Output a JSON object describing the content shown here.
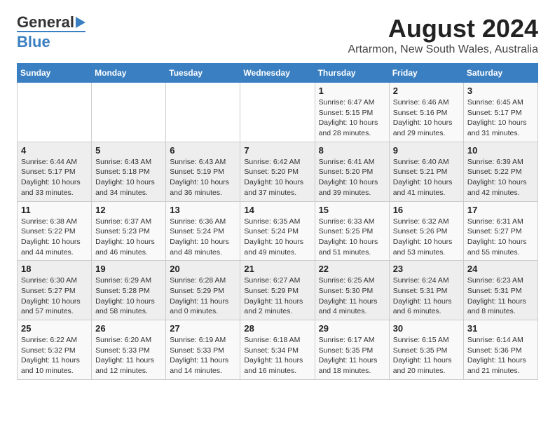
{
  "header": {
    "logo_line1": "General",
    "logo_line2": "Blue",
    "title": "August 2024",
    "subtitle": "Artarmon, New South Wales, Australia"
  },
  "calendar": {
    "days_of_week": [
      "Sunday",
      "Monday",
      "Tuesday",
      "Wednesday",
      "Thursday",
      "Friday",
      "Saturday"
    ],
    "weeks": [
      [
        {
          "day": "",
          "info": ""
        },
        {
          "day": "",
          "info": ""
        },
        {
          "day": "",
          "info": ""
        },
        {
          "day": "",
          "info": ""
        },
        {
          "day": "1",
          "info": "Sunrise: 6:47 AM\nSunset: 5:15 PM\nDaylight: 10 hours\nand 28 minutes."
        },
        {
          "day": "2",
          "info": "Sunrise: 6:46 AM\nSunset: 5:16 PM\nDaylight: 10 hours\nand 29 minutes."
        },
        {
          "day": "3",
          "info": "Sunrise: 6:45 AM\nSunset: 5:17 PM\nDaylight: 10 hours\nand 31 minutes."
        }
      ],
      [
        {
          "day": "4",
          "info": "Sunrise: 6:44 AM\nSunset: 5:17 PM\nDaylight: 10 hours\nand 33 minutes."
        },
        {
          "day": "5",
          "info": "Sunrise: 6:43 AM\nSunset: 5:18 PM\nDaylight: 10 hours\nand 34 minutes."
        },
        {
          "day": "6",
          "info": "Sunrise: 6:43 AM\nSunset: 5:19 PM\nDaylight: 10 hours\nand 36 minutes."
        },
        {
          "day": "7",
          "info": "Sunrise: 6:42 AM\nSunset: 5:20 PM\nDaylight: 10 hours\nand 37 minutes."
        },
        {
          "day": "8",
          "info": "Sunrise: 6:41 AM\nSunset: 5:20 PM\nDaylight: 10 hours\nand 39 minutes."
        },
        {
          "day": "9",
          "info": "Sunrise: 6:40 AM\nSunset: 5:21 PM\nDaylight: 10 hours\nand 41 minutes."
        },
        {
          "day": "10",
          "info": "Sunrise: 6:39 AM\nSunset: 5:22 PM\nDaylight: 10 hours\nand 42 minutes."
        }
      ],
      [
        {
          "day": "11",
          "info": "Sunrise: 6:38 AM\nSunset: 5:22 PM\nDaylight: 10 hours\nand 44 minutes."
        },
        {
          "day": "12",
          "info": "Sunrise: 6:37 AM\nSunset: 5:23 PM\nDaylight: 10 hours\nand 46 minutes."
        },
        {
          "day": "13",
          "info": "Sunrise: 6:36 AM\nSunset: 5:24 PM\nDaylight: 10 hours\nand 48 minutes."
        },
        {
          "day": "14",
          "info": "Sunrise: 6:35 AM\nSunset: 5:24 PM\nDaylight: 10 hours\nand 49 minutes."
        },
        {
          "day": "15",
          "info": "Sunrise: 6:33 AM\nSunset: 5:25 PM\nDaylight: 10 hours\nand 51 minutes."
        },
        {
          "day": "16",
          "info": "Sunrise: 6:32 AM\nSunset: 5:26 PM\nDaylight: 10 hours\nand 53 minutes."
        },
        {
          "day": "17",
          "info": "Sunrise: 6:31 AM\nSunset: 5:27 PM\nDaylight: 10 hours\nand 55 minutes."
        }
      ],
      [
        {
          "day": "18",
          "info": "Sunrise: 6:30 AM\nSunset: 5:27 PM\nDaylight: 10 hours\nand 57 minutes."
        },
        {
          "day": "19",
          "info": "Sunrise: 6:29 AM\nSunset: 5:28 PM\nDaylight: 10 hours\nand 58 minutes."
        },
        {
          "day": "20",
          "info": "Sunrise: 6:28 AM\nSunset: 5:29 PM\nDaylight: 11 hours\nand 0 minutes."
        },
        {
          "day": "21",
          "info": "Sunrise: 6:27 AM\nSunset: 5:29 PM\nDaylight: 11 hours\nand 2 minutes."
        },
        {
          "day": "22",
          "info": "Sunrise: 6:25 AM\nSunset: 5:30 PM\nDaylight: 11 hours\nand 4 minutes."
        },
        {
          "day": "23",
          "info": "Sunrise: 6:24 AM\nSunset: 5:31 PM\nDaylight: 11 hours\nand 6 minutes."
        },
        {
          "day": "24",
          "info": "Sunrise: 6:23 AM\nSunset: 5:31 PM\nDaylight: 11 hours\nand 8 minutes."
        }
      ],
      [
        {
          "day": "25",
          "info": "Sunrise: 6:22 AM\nSunset: 5:32 PM\nDaylight: 11 hours\nand 10 minutes."
        },
        {
          "day": "26",
          "info": "Sunrise: 6:20 AM\nSunset: 5:33 PM\nDaylight: 11 hours\nand 12 minutes."
        },
        {
          "day": "27",
          "info": "Sunrise: 6:19 AM\nSunset: 5:33 PM\nDaylight: 11 hours\nand 14 minutes."
        },
        {
          "day": "28",
          "info": "Sunrise: 6:18 AM\nSunset: 5:34 PM\nDaylight: 11 hours\nand 16 minutes."
        },
        {
          "day": "29",
          "info": "Sunrise: 6:17 AM\nSunset: 5:35 PM\nDaylight: 11 hours\nand 18 minutes."
        },
        {
          "day": "30",
          "info": "Sunrise: 6:15 AM\nSunset: 5:35 PM\nDaylight: 11 hours\nand 20 minutes."
        },
        {
          "day": "31",
          "info": "Sunrise: 6:14 AM\nSunset: 5:36 PM\nDaylight: 11 hours\nand 21 minutes."
        }
      ]
    ]
  }
}
